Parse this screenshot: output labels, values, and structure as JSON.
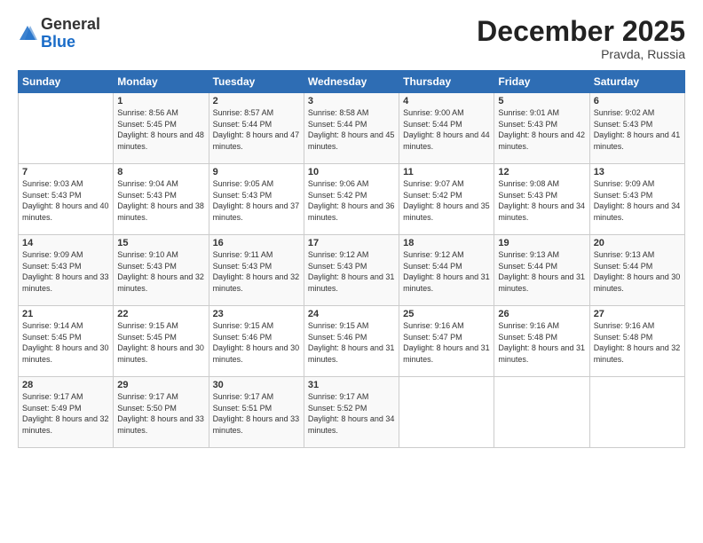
{
  "header": {
    "logo_general": "General",
    "logo_blue": "Blue",
    "month_title": "December 2025",
    "location": "Pravda, Russia"
  },
  "days_of_week": [
    "Sunday",
    "Monday",
    "Tuesday",
    "Wednesday",
    "Thursday",
    "Friday",
    "Saturday"
  ],
  "weeks": [
    [
      {
        "day": "",
        "sunrise": "",
        "sunset": "",
        "daylight": ""
      },
      {
        "day": "1",
        "sunrise": "Sunrise: 8:56 AM",
        "sunset": "Sunset: 5:45 PM",
        "daylight": "Daylight: 8 hours and 48 minutes."
      },
      {
        "day": "2",
        "sunrise": "Sunrise: 8:57 AM",
        "sunset": "Sunset: 5:44 PM",
        "daylight": "Daylight: 8 hours and 47 minutes."
      },
      {
        "day": "3",
        "sunrise": "Sunrise: 8:58 AM",
        "sunset": "Sunset: 5:44 PM",
        "daylight": "Daylight: 8 hours and 45 minutes."
      },
      {
        "day": "4",
        "sunrise": "Sunrise: 9:00 AM",
        "sunset": "Sunset: 5:44 PM",
        "daylight": "Daylight: 8 hours and 44 minutes."
      },
      {
        "day": "5",
        "sunrise": "Sunrise: 9:01 AM",
        "sunset": "Sunset: 5:43 PM",
        "daylight": "Daylight: 8 hours and 42 minutes."
      },
      {
        "day": "6",
        "sunrise": "Sunrise: 9:02 AM",
        "sunset": "Sunset: 5:43 PM",
        "daylight": "Daylight: 8 hours and 41 minutes."
      }
    ],
    [
      {
        "day": "7",
        "sunrise": "Sunrise: 9:03 AM",
        "sunset": "Sunset: 5:43 PM",
        "daylight": "Daylight: 8 hours and 40 minutes."
      },
      {
        "day": "8",
        "sunrise": "Sunrise: 9:04 AM",
        "sunset": "Sunset: 5:43 PM",
        "daylight": "Daylight: 8 hours and 38 minutes."
      },
      {
        "day": "9",
        "sunrise": "Sunrise: 9:05 AM",
        "sunset": "Sunset: 5:43 PM",
        "daylight": "Daylight: 8 hours and 37 minutes."
      },
      {
        "day": "10",
        "sunrise": "Sunrise: 9:06 AM",
        "sunset": "Sunset: 5:42 PM",
        "daylight": "Daylight: 8 hours and 36 minutes."
      },
      {
        "day": "11",
        "sunrise": "Sunrise: 9:07 AM",
        "sunset": "Sunset: 5:42 PM",
        "daylight": "Daylight: 8 hours and 35 minutes."
      },
      {
        "day": "12",
        "sunrise": "Sunrise: 9:08 AM",
        "sunset": "Sunset: 5:43 PM",
        "daylight": "Daylight: 8 hours and 34 minutes."
      },
      {
        "day": "13",
        "sunrise": "Sunrise: 9:09 AM",
        "sunset": "Sunset: 5:43 PM",
        "daylight": "Daylight: 8 hours and 34 minutes."
      }
    ],
    [
      {
        "day": "14",
        "sunrise": "Sunrise: 9:09 AM",
        "sunset": "Sunset: 5:43 PM",
        "daylight": "Daylight: 8 hours and 33 minutes."
      },
      {
        "day": "15",
        "sunrise": "Sunrise: 9:10 AM",
        "sunset": "Sunset: 5:43 PM",
        "daylight": "Daylight: 8 hours and 32 minutes."
      },
      {
        "day": "16",
        "sunrise": "Sunrise: 9:11 AM",
        "sunset": "Sunset: 5:43 PM",
        "daylight": "Daylight: 8 hours and 32 minutes."
      },
      {
        "day": "17",
        "sunrise": "Sunrise: 9:12 AM",
        "sunset": "Sunset: 5:43 PM",
        "daylight": "Daylight: 8 hours and 31 minutes."
      },
      {
        "day": "18",
        "sunrise": "Sunrise: 9:12 AM",
        "sunset": "Sunset: 5:44 PM",
        "daylight": "Daylight: 8 hours and 31 minutes."
      },
      {
        "day": "19",
        "sunrise": "Sunrise: 9:13 AM",
        "sunset": "Sunset: 5:44 PM",
        "daylight": "Daylight: 8 hours and 31 minutes."
      },
      {
        "day": "20",
        "sunrise": "Sunrise: 9:13 AM",
        "sunset": "Sunset: 5:44 PM",
        "daylight": "Daylight: 8 hours and 30 minutes."
      }
    ],
    [
      {
        "day": "21",
        "sunrise": "Sunrise: 9:14 AM",
        "sunset": "Sunset: 5:45 PM",
        "daylight": "Daylight: 8 hours and 30 minutes."
      },
      {
        "day": "22",
        "sunrise": "Sunrise: 9:15 AM",
        "sunset": "Sunset: 5:45 PM",
        "daylight": "Daylight: 8 hours and 30 minutes."
      },
      {
        "day": "23",
        "sunrise": "Sunrise: 9:15 AM",
        "sunset": "Sunset: 5:46 PM",
        "daylight": "Daylight: 8 hours and 30 minutes."
      },
      {
        "day": "24",
        "sunrise": "Sunrise: 9:15 AM",
        "sunset": "Sunset: 5:46 PM",
        "daylight": "Daylight: 8 hours and 31 minutes."
      },
      {
        "day": "25",
        "sunrise": "Sunrise: 9:16 AM",
        "sunset": "Sunset: 5:47 PM",
        "daylight": "Daylight: 8 hours and 31 minutes."
      },
      {
        "day": "26",
        "sunrise": "Sunrise: 9:16 AM",
        "sunset": "Sunset: 5:48 PM",
        "daylight": "Daylight: 8 hours and 31 minutes."
      },
      {
        "day": "27",
        "sunrise": "Sunrise: 9:16 AM",
        "sunset": "Sunset: 5:48 PM",
        "daylight": "Daylight: 8 hours and 32 minutes."
      }
    ],
    [
      {
        "day": "28",
        "sunrise": "Sunrise: 9:17 AM",
        "sunset": "Sunset: 5:49 PM",
        "daylight": "Daylight: 8 hours and 32 minutes."
      },
      {
        "day": "29",
        "sunrise": "Sunrise: 9:17 AM",
        "sunset": "Sunset: 5:50 PM",
        "daylight": "Daylight: 8 hours and 33 minutes."
      },
      {
        "day": "30",
        "sunrise": "Sunrise: 9:17 AM",
        "sunset": "Sunset: 5:51 PM",
        "daylight": "Daylight: 8 hours and 33 minutes."
      },
      {
        "day": "31",
        "sunrise": "Sunrise: 9:17 AM",
        "sunset": "Sunset: 5:52 PM",
        "daylight": "Daylight: 8 hours and 34 minutes."
      },
      {
        "day": "",
        "sunrise": "",
        "sunset": "",
        "daylight": ""
      },
      {
        "day": "",
        "sunrise": "",
        "sunset": "",
        "daylight": ""
      },
      {
        "day": "",
        "sunrise": "",
        "sunset": "",
        "daylight": ""
      }
    ]
  ]
}
